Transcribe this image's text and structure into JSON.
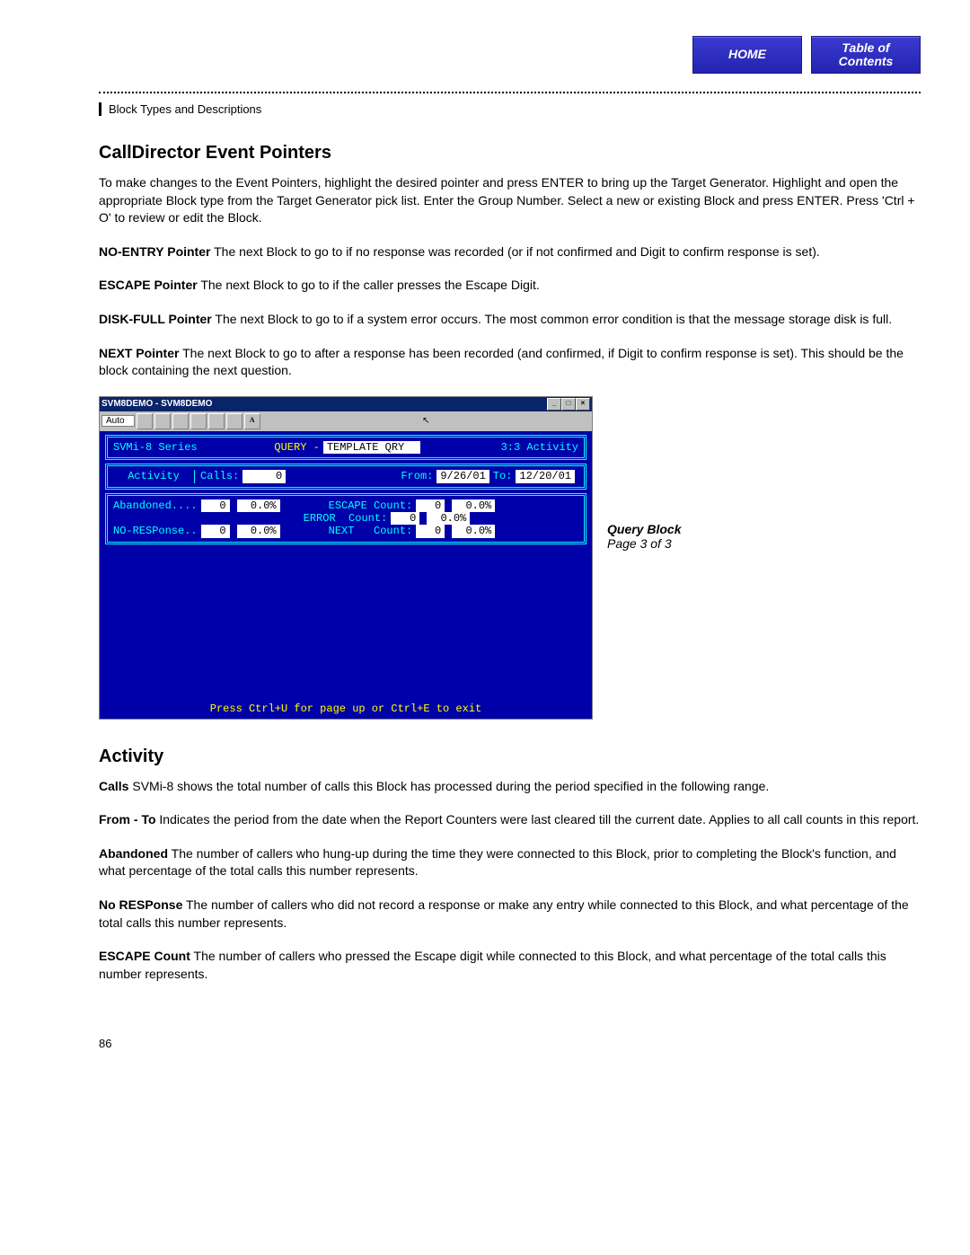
{
  "nav": {
    "home": "HOME",
    "toc_line1": "Table of",
    "toc_line2": "Contents"
  },
  "breadcrumb": "Block Types and Descriptions",
  "section1_title": "CallDirector Event Pointers",
  "intro": "To make changes to the Event Pointers, highlight the desired pointer and press ENTER to bring up the Target Generator.  Highlight and open the appropriate Block type from the Target Generator pick list.  Enter the Group Number.  Select a new or existing Block and press ENTER.  Press 'Ctrl + O' to review or edit the Block.",
  "pointers": {
    "noentry_label": "NO-ENTRY Pointer",
    "noentry_text": "  The next Block to go to if no response was recorded (or if not confirmed and Digit to confirm response is set).",
    "escape_label": "ESCAPE Pointer",
    "escape_text": "   The next Block to go to if the caller presses the Escape Digit.",
    "diskfull_label": "DISK-FULL Pointer",
    "diskfull_text": "   The next Block to go to if a system error occurs. The most common error condition is that the message storage disk is full.",
    "next_label": "NEXT Pointer",
    "next_text": "   The next Block to go to after a response has been recorded (and confirmed, if Digit to confirm response is set). This should be the block containing the next question."
  },
  "caption": {
    "title": "Query Block",
    "page": "Page 3 of 3"
  },
  "section2_title": "Activity",
  "activity": {
    "calls_label": "Calls",
    "calls_text": "   SVMi-8 shows the total number of calls this Block has processed during the period specified in the following range.",
    "fromto_label": "From - To",
    "fromto_text": "   Indicates the period from the date when the Report Counters were last cleared till the current date. Applies to all call counts in this report.",
    "abandoned_label": "Abandoned",
    "abandoned_text": "   The number of callers who hung-up during the time they were connected to this Block, prior to completing the Block's function, and what percentage of the total calls this number represents.",
    "noresp_label": "No RESPonse",
    "noresp_text": "   The number of callers who did not record a response or make any entry while connected to this Block, and what percentage of the total calls this number represents.",
    "esccount_label": "ESCAPE Count",
    "esccount_text": "   The number of callers who pressed the Escape digit while connected to this Block, and what percentage of the total calls this number represents."
  },
  "page_number": "86",
  "terminal": {
    "title": "SVM8DEMO - SVM8DEMO",
    "auto": "Auto",
    "header_left": "SVMi-8 Series",
    "header_mid_query": "QUERY -",
    "header_mid_val": "TEMPLATE QRY",
    "header_right": "3:3 Activity",
    "activity_label": "Activity",
    "calls_label": "Calls:",
    "calls_val": "0",
    "from_label": "From:",
    "from_val": "9/26/01",
    "to_label": "To:",
    "to_val": "12/20/01",
    "abandoned_label": "Abandoned....",
    "abandoned_n": "0",
    "abandoned_p": "0.0%",
    "noresp_label": "NO-RESPonse..",
    "noresp_n": "0",
    "noresp_p": "0.0%",
    "esc_label": "ESCAPE Count:",
    "esc_n": "0",
    "esc_p": "0.0%",
    "err_label": "ERROR  Count:",
    "err_n": "0",
    "err_p": "0.0%",
    "nxt_label": "NEXT   Count:",
    "nxt_n": "0",
    "nxt_p": "0.0%",
    "footer": "Press Ctrl+U for page up or Ctrl+E to exit"
  }
}
